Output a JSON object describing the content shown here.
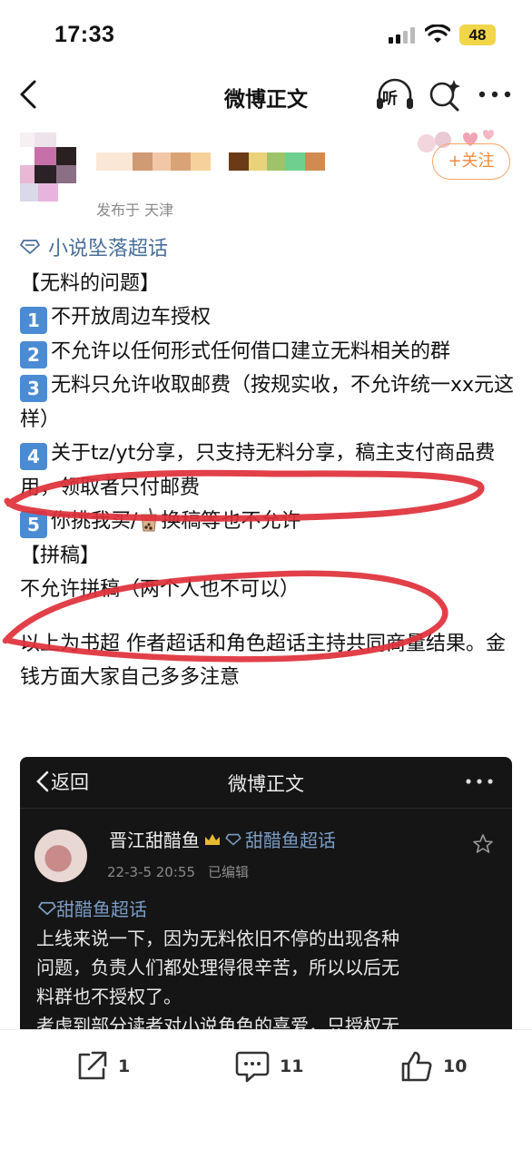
{
  "status_bar": {
    "time": "17:33",
    "battery": "48"
  },
  "nav": {
    "title": "微博正文",
    "listen_label": "听"
  },
  "author": {
    "location": "发布于 天津",
    "follow_label": "+关注"
  },
  "post": {
    "topic": "小说坠落超话",
    "section1_title": "【无料的问题】",
    "items": [
      {
        "num": "1",
        "text": "不开放周边车授权"
      },
      {
        "num": "2",
        "text": "不允许以任何形式任何借口建立无料相关的群"
      },
      {
        "num": "3",
        "text": "无料只允许收取邮费（按规实收，不允许统一xx元这样）"
      },
      {
        "num": "4",
        "text": "关于tz/yt分享，只支持无料分享，稿主支付商品费用，领取者只付邮费"
      },
      {
        "num": "5",
        "text_before": "你挑我买/",
        "text_after": "换稿等也不允许"
      }
    ],
    "section2_title": "【拼稿】",
    "section2_text": "不允许拼稿（两个人也不可以）",
    "closing": "以上为书超 作者超话和角色超话主持共同商量结果。金钱方面大家自己多多注意"
  },
  "embed": {
    "back_label": "返回",
    "title": "微博正文",
    "user_name": "晋江甜醋鱼",
    "user_chaohua": "甜醋鱼超话",
    "date": "22-3-5 20:55",
    "edited": "已编辑",
    "topic": "甜醋鱼超话",
    "body_lines": [
      "上线来说一下，因为无料依旧不停的出现各种",
      "问题，负责人们都处理得很辛苦，所以以后无",
      "料群也不授权了。",
      "考虑到部分读者对小说角色的喜爱，只授权无"
    ]
  },
  "bottom_bar": {
    "share_count": "1",
    "comment_count": "11",
    "like_count": "10"
  },
  "colors": {
    "topic_blue": "#4a6f9a",
    "follow_orange": "#f08a3d",
    "number_box_blue": "#4a8bd4",
    "annotation_red": "#e0303a"
  }
}
